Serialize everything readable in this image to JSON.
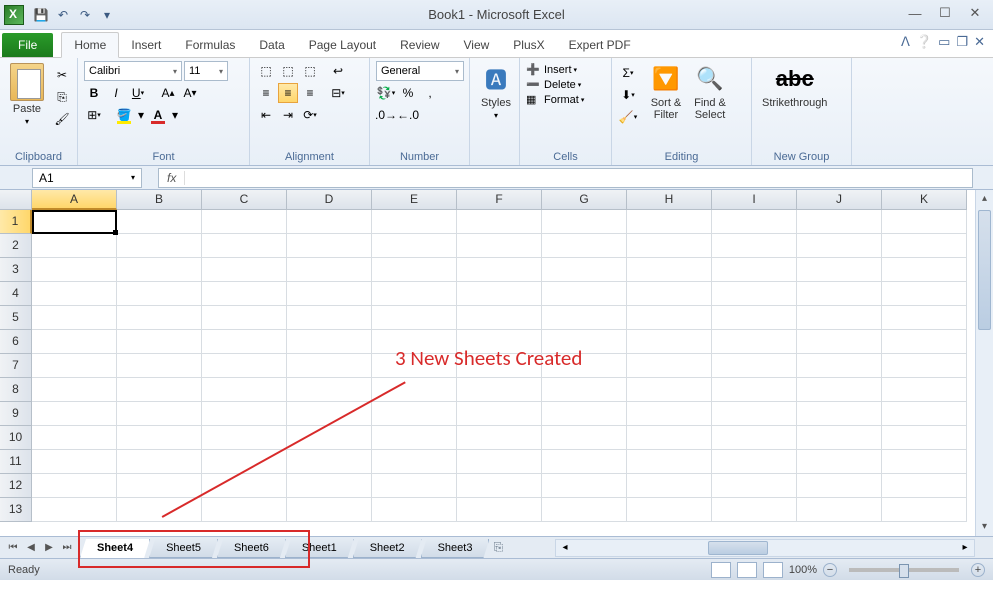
{
  "title": "Book1 - Microsoft Excel",
  "qat": {
    "save": "💾",
    "undo": "↶",
    "redo": "↷"
  },
  "tabs": {
    "file": "File",
    "list": [
      "Home",
      "Insert",
      "Formulas",
      "Data",
      "Page Layout",
      "Review",
      "View",
      "PlusX",
      "Expert PDF"
    ],
    "active": "Home"
  },
  "ribbon": {
    "clipboard": {
      "paste": "Paste",
      "label": "Clipboard"
    },
    "font": {
      "name": "Calibri",
      "size": "11",
      "label": "Font"
    },
    "alignment": {
      "label": "Alignment"
    },
    "number": {
      "format": "General",
      "label": "Number"
    },
    "styles": {
      "btn": "Styles",
      "label": ""
    },
    "cells": {
      "insert": "Insert",
      "delete": "Delete",
      "format": "Format",
      "label": "Cells"
    },
    "editing": {
      "sort": "Sort &\nFilter",
      "find": "Find &\nSelect",
      "label": "Editing"
    },
    "newgroup": {
      "strike": "Strikethrough",
      "label": "New Group"
    }
  },
  "namebox": "A1",
  "columns": [
    "A",
    "B",
    "C",
    "D",
    "E",
    "F",
    "G",
    "H",
    "I",
    "J",
    "K"
  ],
  "rows": [
    "1",
    "2",
    "3",
    "4",
    "5",
    "6",
    "7",
    "8",
    "9",
    "10",
    "11",
    "12",
    "13"
  ],
  "annotation": "3 New Sheets Created",
  "sheets": [
    "Sheet4",
    "Sheet5",
    "Sheet6",
    "Sheet1",
    "Sheet2",
    "Sheet3"
  ],
  "active_sheet": "Sheet4",
  "status": {
    "ready": "Ready",
    "zoom": "100%"
  }
}
